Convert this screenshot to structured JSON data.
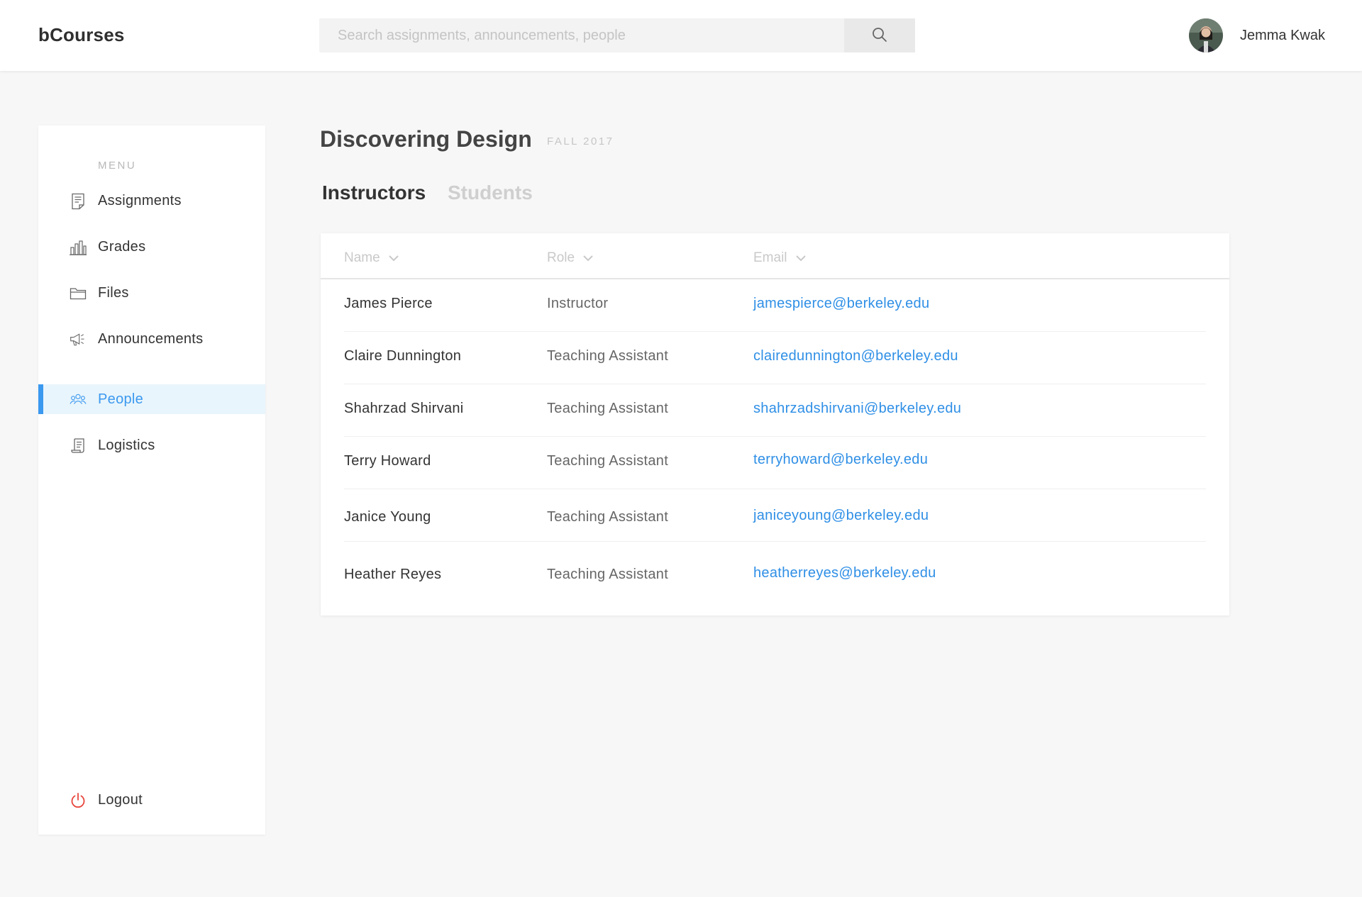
{
  "header": {
    "logo": "bCourses",
    "search_placeholder": "Search assignments, announcements, people",
    "user_name": "Jemma Kwak"
  },
  "sidebar": {
    "menu_title": "MENU",
    "items": [
      {
        "label": "Assignments",
        "icon": "document-icon"
      },
      {
        "label": "Grades",
        "icon": "bar-chart-icon"
      },
      {
        "label": "Files",
        "icon": "folder-icon"
      },
      {
        "label": "Announcements",
        "icon": "megaphone-icon"
      },
      {
        "label": "People",
        "icon": "people-icon",
        "active": true
      },
      {
        "label": "Logistics",
        "icon": "scroll-icon"
      }
    ],
    "logout_label": "Logout"
  },
  "course": {
    "title": "Discovering Design",
    "term": "FALL 2017"
  },
  "tabs": {
    "instructors": "Instructors",
    "students": "Students",
    "active": "Instructors"
  },
  "table": {
    "columns": [
      "Name",
      "Role",
      "Email"
    ],
    "rows": [
      {
        "name": "James Pierce",
        "role": "Instructor",
        "email": "jamespierce@berkeley.edu"
      },
      {
        "name": "Claire Dunnington",
        "role": "Teaching Assistant",
        "email": "clairedunnington@berkeley.edu"
      },
      {
        "name": "Shahrzad Shirvani",
        "role": "Teaching Assistant",
        "email": "shahrzadshirvani@berkeley.edu"
      },
      {
        "name": "Terry Howard",
        "role": "Teaching Assistant",
        "email": "terryhoward@berkeley.edu"
      },
      {
        "name": "Janice Young",
        "role": "Teaching Assistant",
        "email": "janiceyoung@berkeley.edu"
      },
      {
        "name": "Heather Reyes",
        "role": "Teaching Assistant",
        "email": "heatherreyes@berkeley.edu"
      }
    ]
  },
  "colors": {
    "accent": "#3b99f0",
    "link": "#2f8fe6",
    "logout_icon": "#e8453c"
  }
}
